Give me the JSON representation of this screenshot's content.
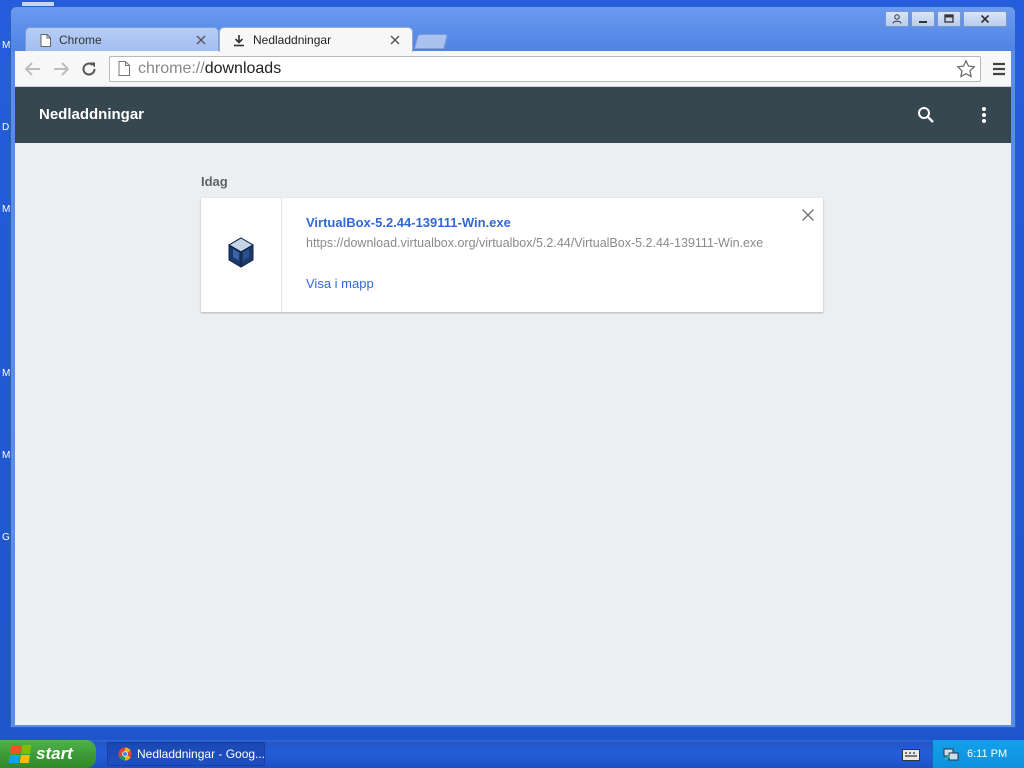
{
  "desktop": {
    "side_labels": [
      "M",
      "D",
      "M",
      "M",
      "M",
      "G"
    ]
  },
  "window": {
    "tabs": [
      {
        "label": "Chrome",
        "icon": "page-icon",
        "active": false
      },
      {
        "label": "Nedladdningar",
        "icon": "download-icon",
        "active": true
      }
    ],
    "controls": [
      "user-icon",
      "minimize-icon",
      "maximize-icon",
      "close-icon"
    ]
  },
  "toolbar": {
    "url_scheme": "chrome://",
    "url_path": "downloads"
  },
  "downloads_page": {
    "title": "Nedladdningar",
    "date_group": "Idag",
    "items": [
      {
        "file_name": "VirtualBox-5.2.44-139111-Win.exe",
        "url": "https://download.virtualbox.org/virtualbox/5.2.44/VirtualBox-5.2.44-139111-Win.exe",
        "action": "Visa i mapp",
        "icon": "virtualbox-icon"
      }
    ]
  },
  "taskbar": {
    "start_label": "start",
    "task_item_label": "Nedladdningar - Goog...",
    "clock": "6:11 PM"
  },
  "colors": {
    "header": "#37474f",
    "link": "#3367d6",
    "content_bg": "#eceff1"
  }
}
